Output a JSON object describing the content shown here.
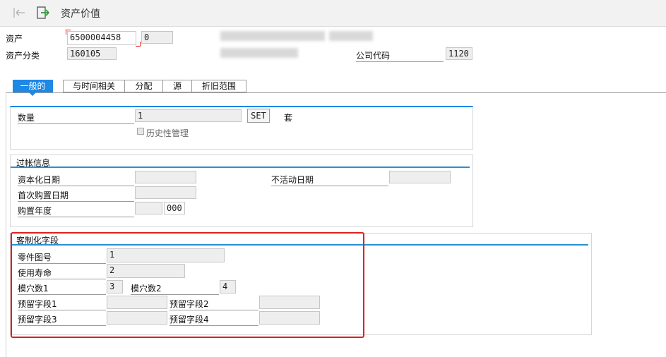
{
  "window": {
    "title": "资产价值"
  },
  "header": {
    "asset_label": "资产",
    "asset_number": "6500004458",
    "asset_sub": "0",
    "asset_class_label": "资产分类",
    "asset_class_value": "160105",
    "company_code_label": "公司代码",
    "company_code_value": "1120"
  },
  "tabs": [
    {
      "label": "一般的"
    },
    {
      "label": "与时间相关"
    },
    {
      "label": "分配"
    },
    {
      "label": "源"
    },
    {
      "label": "折旧范围"
    }
  ],
  "general": {
    "quantity_label": "数量",
    "quantity_value": "1",
    "unit_button": "SET",
    "unit_text": "套",
    "history_label": "历史性管理"
  },
  "posting": {
    "title": "过帐信息",
    "cap_date_label": "资本化日期",
    "inactive_date_label": "不活动日期",
    "first_acq_label": "首次购置日期",
    "acq_year_label": "购置年度",
    "acq_year_period": "000"
  },
  "custom": {
    "title": "客制化字段",
    "part_no_label": "零件图号",
    "part_no_value": "1",
    "life_label": "使用寿命",
    "life_value": "2",
    "mold1_label": "模穴数1",
    "mold1_value": "3",
    "mold2_label": "模穴数2",
    "mold2_value": "4",
    "res1_label": "预留字段1",
    "res2_label": "预留字段2",
    "res3_label": "预留字段3",
    "res4_label": "预留字段4"
  },
  "colors": {
    "accent": "#1e88e5",
    "highlight": "#e02020"
  },
  "icons": {
    "back": "back-arrow-icon",
    "exit": "exit-icon"
  }
}
